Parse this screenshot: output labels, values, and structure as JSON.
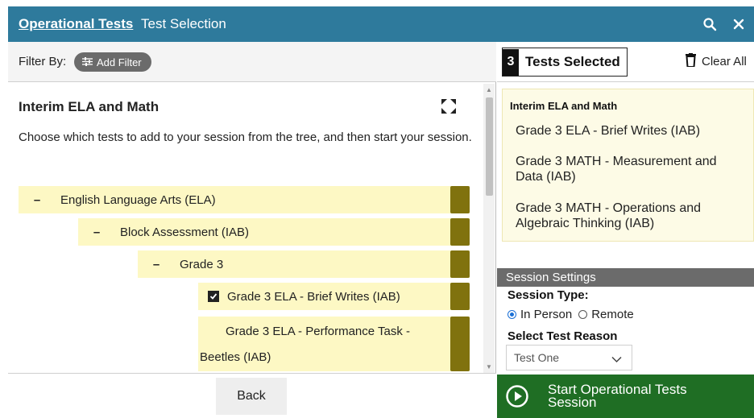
{
  "header": {
    "title_link": "Operational Tests",
    "title_sub": "Test Selection",
    "search_icon": "search-icon",
    "close_icon": "close-icon"
  },
  "filter": {
    "label": "Filter By:",
    "add_filter_label": "Add Filter"
  },
  "tree": {
    "heading": "Interim ELA and Math",
    "description": "Choose which tests to add to your session from the tree, and then start your session.",
    "nodes": [
      {
        "label": "English Language Arts (ELA)",
        "sign": "–"
      },
      {
        "label": "Block Assessment (IAB)",
        "sign": "–"
      },
      {
        "label": "Grade 3",
        "sign": "–"
      },
      {
        "label": "Grade 3 ELA - Brief Writes (IAB)",
        "checked": true
      },
      {
        "label_line1": "Grade 3 ELA - Performance Task -",
        "label_line2": "Beetles (IAB)",
        "checked": false
      }
    ]
  },
  "footer": {
    "back_label": "Back"
  },
  "selected": {
    "count": "3",
    "label": "Tests Selected",
    "clear_all": "Clear All",
    "group_title": "Interim ELA and Math",
    "items": [
      {
        "line1": "Grade 3 ELA - Brief Writes (IAB)"
      },
      {
        "line1": "Grade 3 MATH - Measurement and",
        "line2": "Data (IAB)"
      },
      {
        "line1": "Grade 3 MATH - Operations and",
        "line2": "Algebraic Thinking (IAB)"
      }
    ]
  },
  "session": {
    "header": "Session Settings",
    "type_label": "Session Type:",
    "in_person": "In Person",
    "remote": "Remote",
    "selected_type": "In Person",
    "reason_label": "Select Test Reason",
    "reason_value": "Test One"
  },
  "start": {
    "line1": "Start Operational Tests",
    "line2": "Session"
  },
  "colors": {
    "header_bg": "#2e7a9c",
    "tree_row_bg": "#fdf8c4",
    "tree_handle": "#80720e",
    "start_bg": "#1f6e24",
    "session_header_bg": "#6b6b6b"
  }
}
